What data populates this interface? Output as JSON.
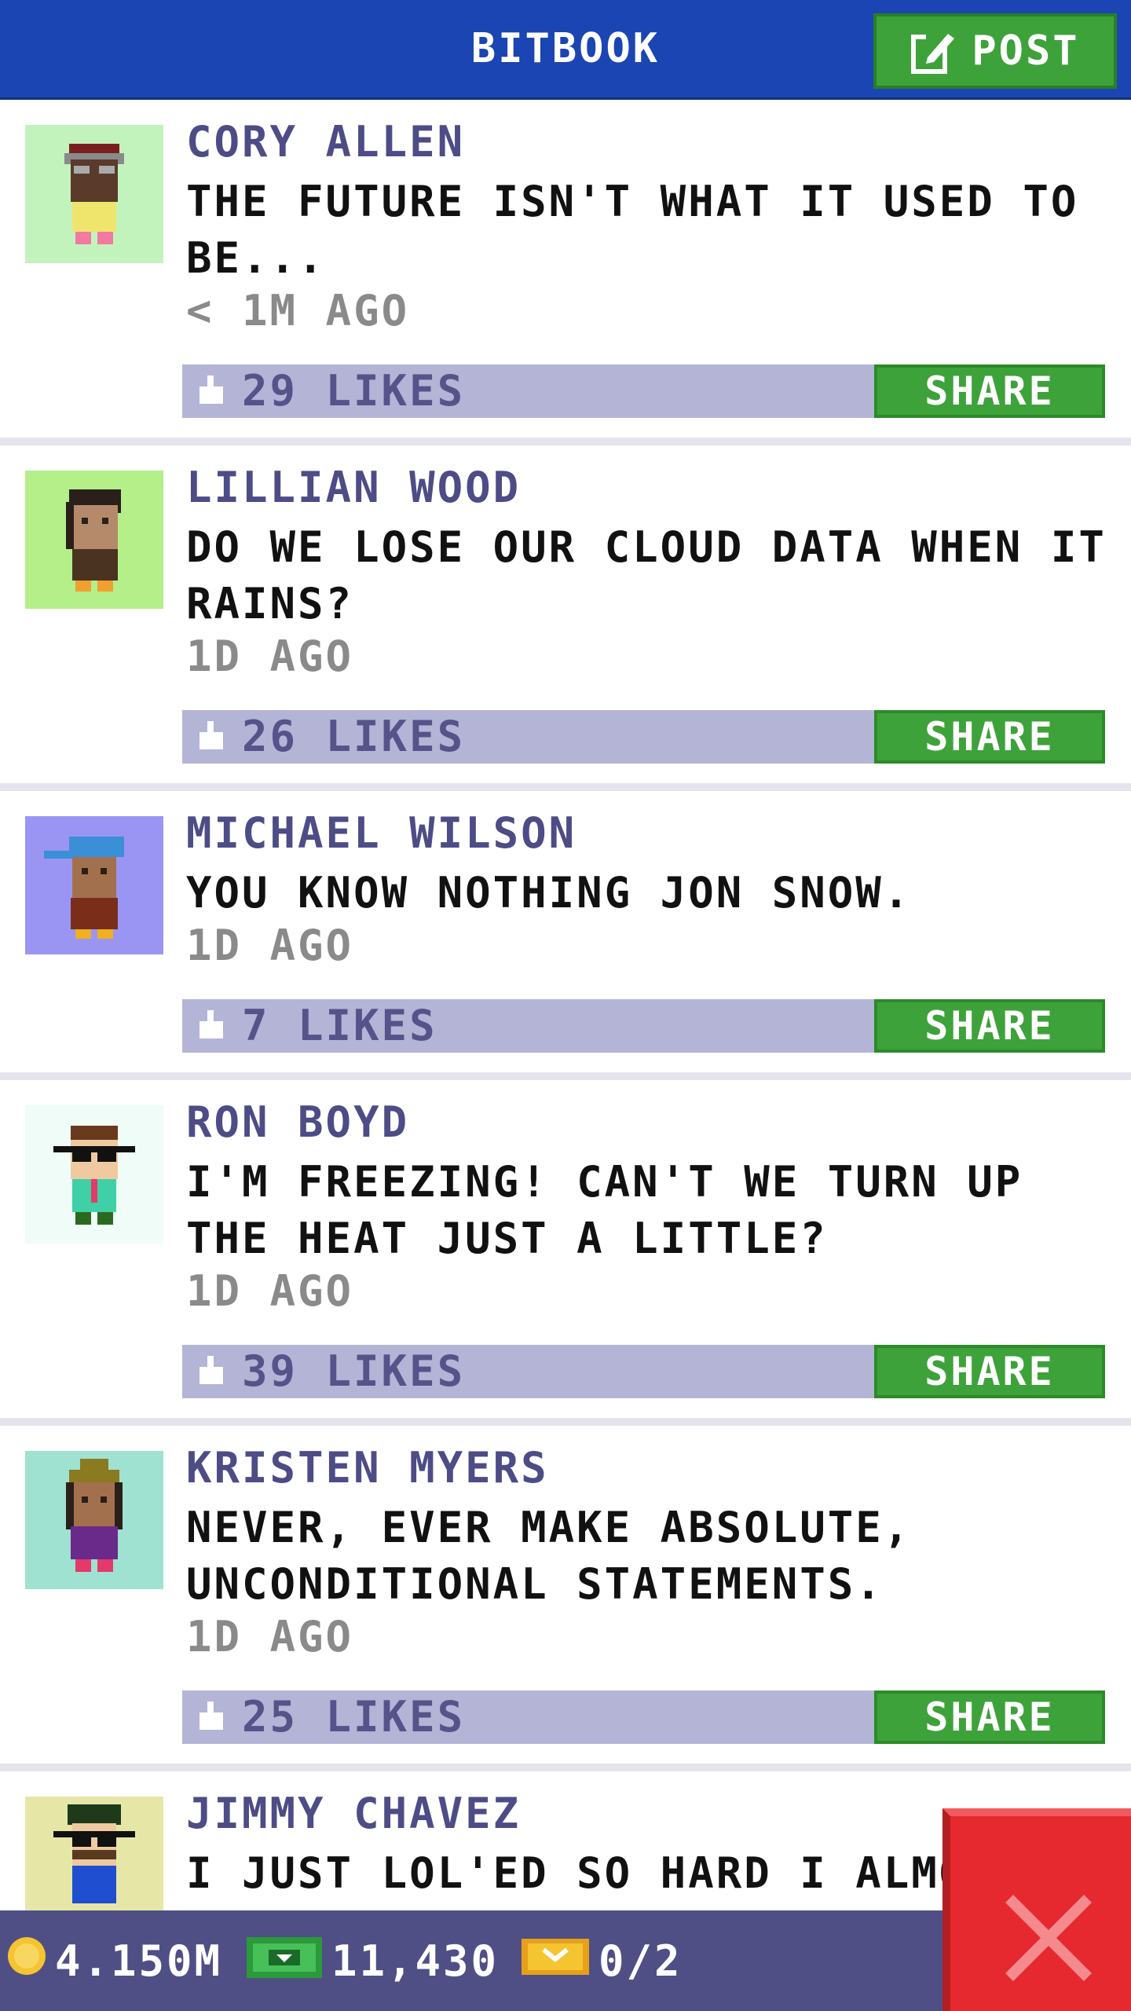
{
  "header": {
    "title": "BITBOOK",
    "post_label": "POST"
  },
  "posts": [
    {
      "author": "CORY ALLEN",
      "message": "THE FUTURE ISN'T WHAT IT USED TO BE...",
      "time": "< 1M AGO",
      "likes": "29 LIKES",
      "share_label": "SHARE",
      "avatar_bg": "#c3f3bd"
    },
    {
      "author": "LILLIAN WOOD",
      "message": "DO WE LOSE OUR CLOUD DATA WHEN IT RAINS?",
      "time": "1D AGO",
      "likes": "26 LIKES",
      "share_label": "SHARE",
      "avatar_bg": "#b4ef8a"
    },
    {
      "author": "MICHAEL WILSON",
      "message": "YOU KNOW NOTHING JON SNOW.",
      "time": "1D AGO",
      "likes": "7 LIKES",
      "share_label": "SHARE",
      "avatar_bg": "#9a95f3"
    },
    {
      "author": "RON BOYD",
      "message": "I'M FREEZING! CAN'T WE TURN UP THE HEAT JUST A LITTLE?",
      "time": "1D AGO",
      "likes": "39 LIKES",
      "share_label": "SHARE",
      "avatar_bg": "#effcf7"
    },
    {
      "author": "KRISTEN MYERS",
      "message": "NEVER, EVER MAKE ABSOLUTE, UNCONDITIONAL STATEMENTS.",
      "time": "1D AGO",
      "likes": "25 LIKES",
      "share_label": "SHARE",
      "avatar_bg": "#9fe2d1"
    },
    {
      "author": "JIMMY CHAVEZ",
      "message": "I JUST LOL'ED SO HARD I ALMOS",
      "avatar_bg": "#e6e7a6"
    }
  ],
  "bottom": {
    "coins": "4.150M",
    "bux": "11,430",
    "tickets": "0/2"
  },
  "colors": {
    "header": "#1b45b2",
    "accent_green": "#3ea23a",
    "likes_bar": "#b3b4d6",
    "bottom_bar": "#4f4f86",
    "close": "#e5292f"
  }
}
